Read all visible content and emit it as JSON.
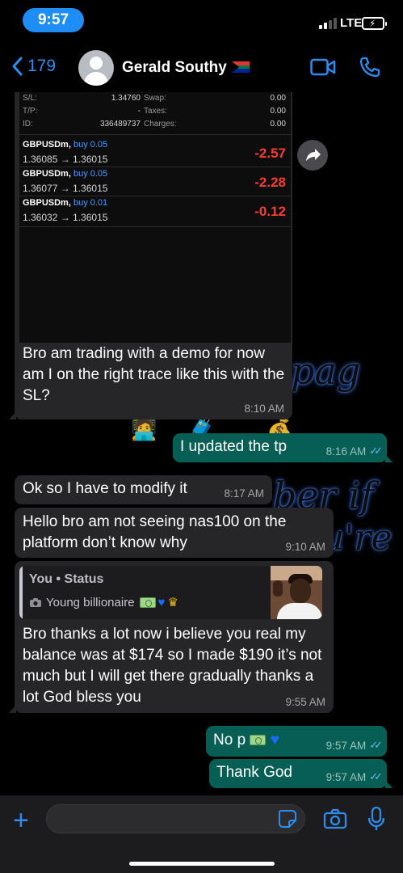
{
  "status_bar": {
    "time": "9:57",
    "network": "LTE"
  },
  "header": {
    "back_count": "179",
    "contact_name": "Gerald Southy"
  },
  "screenshot": {
    "rows": [
      {
        "label": "S/L:",
        "value": "1.34760",
        "label2": "Swap:",
        "value2": "0.00"
      },
      {
        "label": "T/P:",
        "value": "-",
        "label2": "Taxes:",
        "value2": "0.00"
      },
      {
        "label": "ID:",
        "value": "336489737",
        "label2": "Charges:",
        "value2": "0.00"
      }
    ],
    "trades": [
      {
        "symbol": "GBPUSDm,",
        "side": "buy 0.05",
        "prices": "1.36085 → 1.36015",
        "pl": "-2.57"
      },
      {
        "symbol": "GBPUSDm,",
        "side": "buy 0.05",
        "prices": "1.36077 → 1.36015",
        "pl": "-2.28"
      },
      {
        "symbol": "GBPUSDm,",
        "side": "buy 0.01",
        "prices": "1.36032 → 1.36015",
        "pl": "-0.12"
      }
    ]
  },
  "messages": [
    {
      "id": "m1",
      "dir": "in",
      "text": "Bro am trading with a demo for now am I on the right trace like this with the SL?",
      "time": "8:10 AM"
    },
    {
      "id": "m2",
      "dir": "out",
      "text": "I updated the tp",
      "time": "8:16 AM"
    },
    {
      "id": "m3",
      "dir": "in",
      "text": "Ok so I have to modify it",
      "time": "8:17 AM"
    },
    {
      "id": "m4",
      "dir": "in",
      "text": "Hello bro am not seeing nas100 on the platform don’t know why",
      "time": "9:10 AM"
    },
    {
      "id": "m5",
      "dir": "in",
      "text": "Bro thanks a lot now i believe you real my balance was at $174 so I made $190 it’s not much but I will get there gradually thanks a lot God bless you",
      "time": "9:55 AM",
      "quote": {
        "author": "You • Status",
        "caption": "Young billionaire"
      }
    },
    {
      "id": "m6",
      "dir": "out",
      "text": "No p",
      "time": "9:57 AM"
    },
    {
      "id": "m7",
      "dir": "out",
      "text": "Thank God",
      "time": "9:57 AM"
    }
  ],
  "background_text": [
    "pag",
    "ber if",
    "u're"
  ],
  "icons": [
    "chevron-left-icon",
    "video-call-icon",
    "phone-icon",
    "forward-icon",
    "plus-icon",
    "sticker-icon",
    "camera-icon",
    "microphone-icon"
  ],
  "colors": {
    "accent": "#2e8cf0",
    "outgoing_bubble": "#075e54",
    "incoming_bubble": "#262628",
    "loss": "#ff3b30",
    "read_ticks": "#67b7f0"
  }
}
